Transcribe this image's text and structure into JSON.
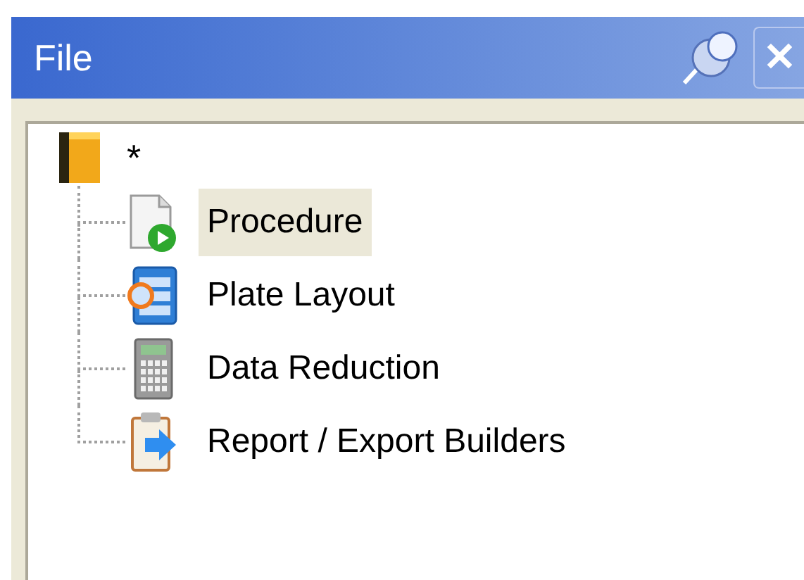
{
  "panel": {
    "title": "File",
    "close_label": "✕"
  },
  "tree": {
    "root": {
      "label": "*",
      "kind": "book",
      "children": [
        {
          "label": "Procedure",
          "kind": "procedure",
          "selected": true
        },
        {
          "label": "Plate Layout",
          "kind": "plate",
          "selected": false
        },
        {
          "label": "Data Reduction",
          "kind": "calculator",
          "selected": false
        },
        {
          "label": "Report / Export Builders",
          "kind": "report",
          "selected": false
        }
      ]
    }
  }
}
